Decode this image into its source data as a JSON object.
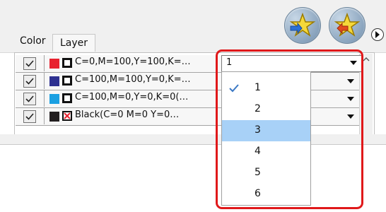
{
  "tabs": [
    "Color",
    "Layer"
  ],
  "layers": [
    {
      "name": "C=0,M=100,Y=100,K=…",
      "color": "#e8212f",
      "x": false
    },
    {
      "name": "C=100,M=100,Y=0,K=…",
      "color": "#2e3191",
      "x": false
    },
    {
      "name": "C=100,M=0,Y=0,K=0(…",
      "color": "#1ba0e2",
      "x": false
    },
    {
      "name": "Black(C=0 M=0 Y=0…",
      "color": "#231f20",
      "x": true
    }
  ],
  "select": {
    "value": "1"
  },
  "dropdown": {
    "options": [
      "1",
      "2",
      "3",
      "4",
      "5",
      "6"
    ],
    "checked": "1",
    "highlighted": "3"
  },
  "colors": {
    "highlight": "#e0181a",
    "selected_bg": "#a8d1f7"
  }
}
